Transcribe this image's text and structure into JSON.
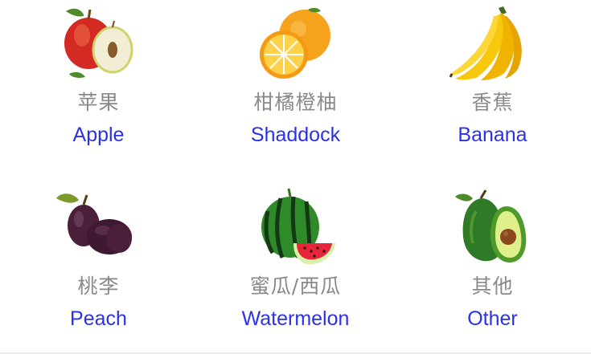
{
  "fruits": [
    {
      "zh": "苹果",
      "en": "Apple",
      "icon": "apple-icon"
    },
    {
      "zh": "柑橘橙柚",
      "en": "Shaddock",
      "icon": "orange-icon"
    },
    {
      "zh": "香蕉",
      "en": "Banana",
      "icon": "banana-icon"
    },
    {
      "zh": "桃李",
      "en": "Peach",
      "icon": "plum-icon"
    },
    {
      "zh": "蜜瓜/西瓜",
      "en": "Watermelon",
      "icon": "watermelon-icon"
    },
    {
      "zh": "其他",
      "en": "Other",
      "icon": "avocado-icon"
    }
  ],
  "colors": {
    "english_label": "#2b31e6",
    "chinese_label": "#8a8a8a",
    "background": "#ffffff"
  }
}
